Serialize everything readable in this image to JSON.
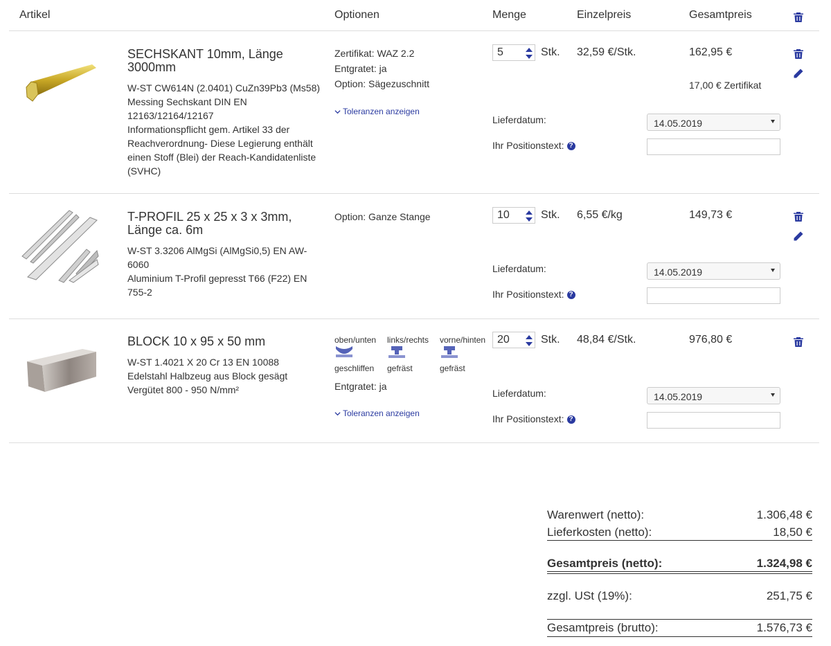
{
  "header": {
    "article": "Artikel",
    "options": "Optionen",
    "quantity": "Menge",
    "unit_price": "Einzelpreis",
    "total_price": "Gesamtpreis"
  },
  "items": [
    {
      "title": "SECHSKANT 10mm, Länge 3000mm",
      "desc": [
        "W-ST CW614N (2.0401) CuZn39Pb3 (Ms58)",
        "Messing Sechskant DIN EN",
        "12163/12164/12167",
        "Informationspflicht gem. Artikel 33 der",
        "Reachverordnung- Diese Legierung enthält",
        "einen Stoff (Blei) der Reach-Kandidatenliste",
        "(SVHC)"
      ],
      "options": [
        "Zertifikat: WAZ 2.2",
        "Entgratet: ja",
        "Option: Sägezuschnitt"
      ],
      "tolerances": "Toleranzen anzeigen",
      "qty": "5",
      "unit": "Stk.",
      "unit_price": "32,59 €/Stk.",
      "total": "162,95 €",
      "extra": "17,00 € Zertifikat",
      "delivery_label": "Lieferdatum:",
      "delivery_date": "14.05.2019",
      "pos_label": "Ihr Positionstext:"
    },
    {
      "title": "T-PROFIL 25 x 25 x 3 x 3mm, Länge ca. 6m",
      "desc": [
        "W-ST 3.3206 AlMgSi (AlMgSi0,5) EN AW-",
        "6060",
        "Aluminium T-Profil gepresst T66 (F22) EN",
        "755-2"
      ],
      "options": [
        "Option: Ganze Stange"
      ],
      "qty": "10",
      "unit": "Stk.",
      "unit_price": "6,55 €/kg",
      "total": "149,73 €",
      "delivery_label": "Lieferdatum:",
      "delivery_date": "14.05.2019",
      "pos_label": "Ihr Positionstext:"
    },
    {
      "title": "BLOCK 10 x 95 x 50 mm",
      "desc": [
        "W-ST 1.4021 X 20 Cr 13 EN 10088",
        "Edelstahl Halbzeug aus Block gesägt",
        "Vergütet 800 - 950 N/mm²"
      ],
      "processing": [
        {
          "top": "oben/unten",
          "bottom": "geschliffen"
        },
        {
          "top": "links/rechts",
          "bottom": "gefräst"
        },
        {
          "top": "vorne/hinten",
          "bottom": "gefräst"
        }
      ],
      "options": [
        "Entgratet: ja"
      ],
      "tolerances": "Toleranzen anzeigen",
      "qty": "20",
      "unit": "Stk.",
      "unit_price": "48,84 €/Stk.",
      "total": "976,80 €",
      "delivery_label": "Lieferdatum:",
      "delivery_date": "14.05.2019",
      "pos_label": "Ihr Positionstext:"
    }
  ],
  "summary": {
    "goods_label": "Warenwert (netto):",
    "goods_value": "1.306,48 €",
    "shipping_label": "Lieferkosten (netto):",
    "shipping_value": "18,50 €",
    "net_label": "Gesamtpreis (netto):",
    "net_value": "1.324,98 €",
    "vat_label": "zzgl. USt (19%):",
    "vat_value": "251,75 €",
    "gross_label": "Gesamtpreis (brutto):",
    "gross_value": "1.576,73 €"
  },
  "colors": {
    "accent": "#2a3aa0",
    "border": "#dddddd"
  }
}
